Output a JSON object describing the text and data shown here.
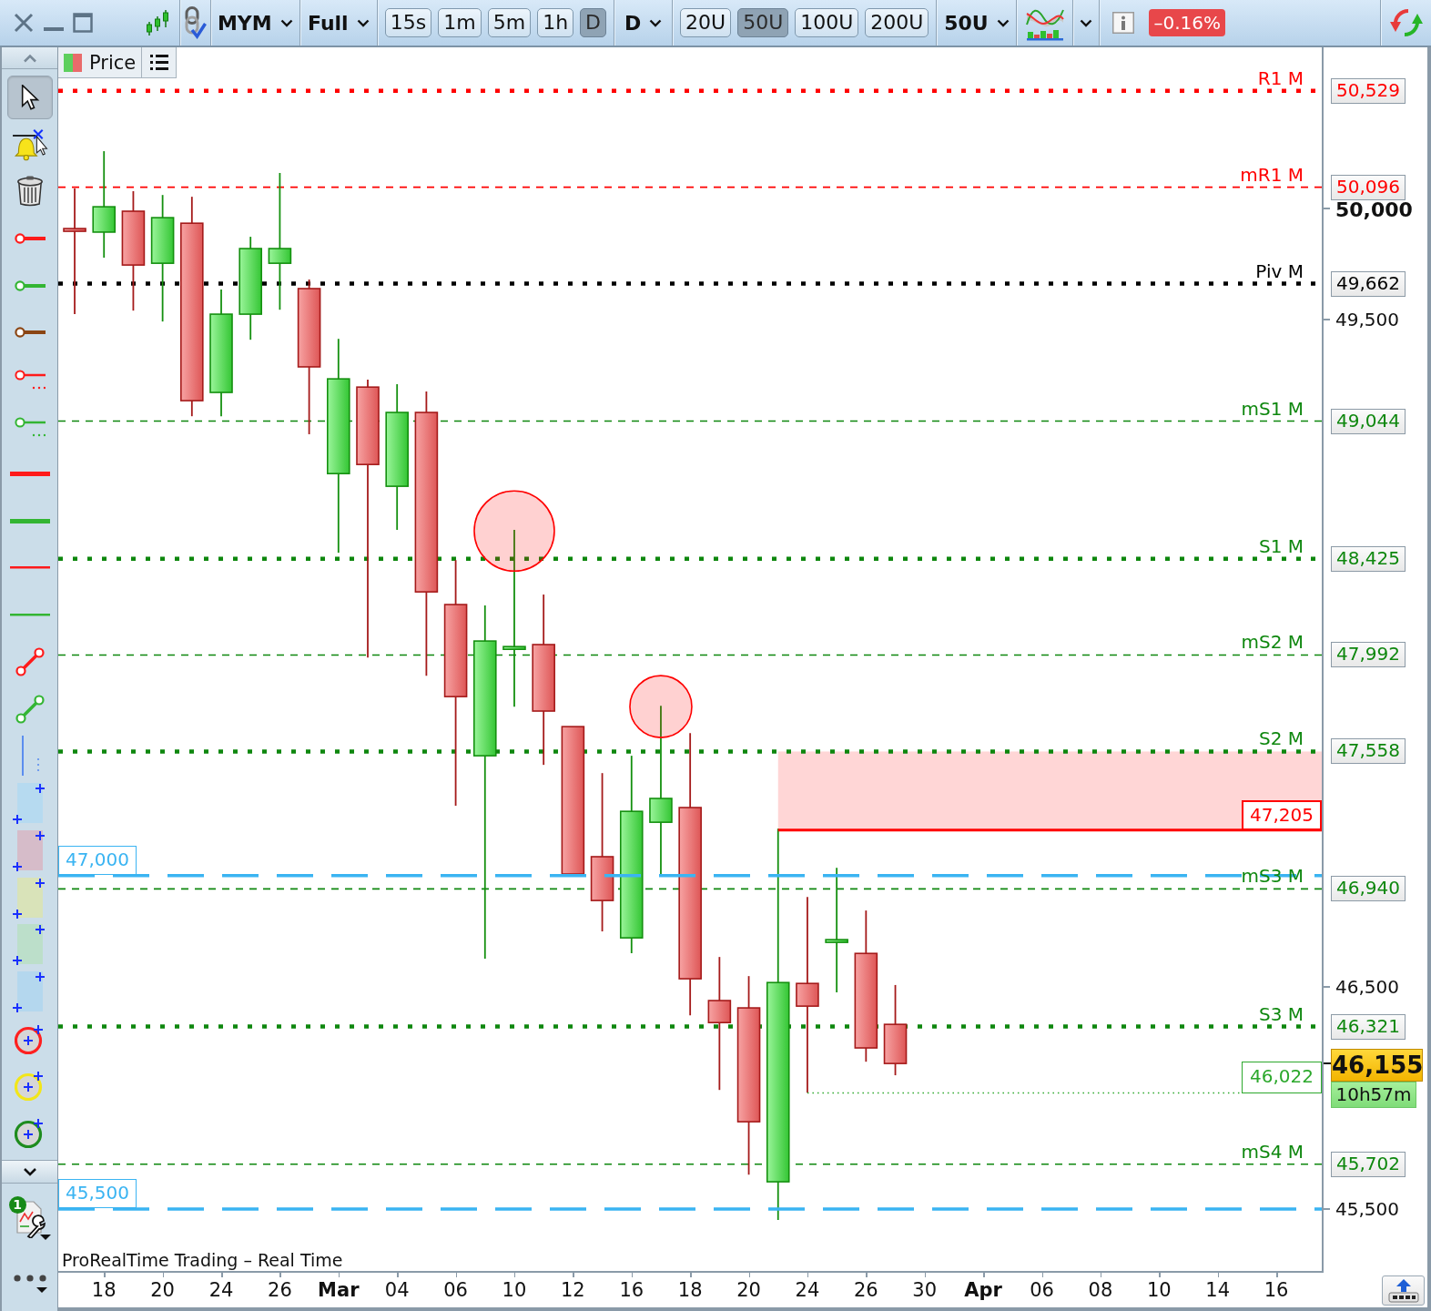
{
  "toolbar": {
    "instrument": "MYM",
    "range": "Full",
    "timeframes": [
      {
        "label": "15s",
        "selected": false
      },
      {
        "label": "1m",
        "selected": false
      },
      {
        "label": "5m",
        "selected": false
      },
      {
        "label": "1h",
        "selected": false
      },
      {
        "label": "D",
        "selected": true
      }
    ],
    "period": "D",
    "units": [
      {
        "label": "20U",
        "selected": false
      },
      {
        "label": "50U",
        "selected": true
      },
      {
        "label": "100U",
        "selected": false
      },
      {
        "label": "200U",
        "selected": false
      }
    ],
    "unit_menu": "50U",
    "change": "–0.16%"
  },
  "left_toolbar": {
    "tools": [
      {
        "kind": "pointer",
        "selected": true
      },
      {
        "kind": "alert",
        "selected": false
      },
      {
        "kind": "trash",
        "selected": false
      },
      {
        "kind": "ray",
        "color": "#ff1a1a",
        "selected": false
      },
      {
        "kind": "ray",
        "color": "#33b533",
        "selected": false
      },
      {
        "kind": "ray",
        "color": "#8b4513",
        "selected": false
      },
      {
        "kind": "ray-dotted",
        "color": "#ff1a1a",
        "selected": false
      },
      {
        "kind": "ray-dotted",
        "color": "#33b533",
        "selected": false
      },
      {
        "kind": "thick-line",
        "color": "#ff1a1a",
        "selected": false
      },
      {
        "kind": "thick-line",
        "color": "#33b533",
        "selected": false
      },
      {
        "kind": "thin-line",
        "color": "#ff1a1a",
        "selected": false
      },
      {
        "kind": "thin-line",
        "color": "#33b533",
        "selected": false
      },
      {
        "kind": "segment",
        "color": "#ff1a1a",
        "selected": false
      },
      {
        "kind": "segment",
        "color": "#33b533",
        "selected": false
      },
      {
        "kind": "vline",
        "color": "#5b8def",
        "selected": false
      },
      {
        "kind": "rect",
        "color": "#b6daf0",
        "selected": false
      },
      {
        "kind": "rect",
        "color": "#d6bcc9",
        "selected": false
      },
      {
        "kind": "rect",
        "color": "#d9e3b9",
        "selected": false
      },
      {
        "kind": "rect",
        "color": "#bcdfca",
        "selected": false
      },
      {
        "kind": "rect",
        "color": "#b4d7ee",
        "selected": false
      },
      {
        "kind": "circle",
        "color": "#ff2020",
        "selected": false
      },
      {
        "kind": "circle",
        "color": "#f2e61a",
        "selected": false
      },
      {
        "kind": "circle",
        "color": "#1e8c1e",
        "selected": false
      }
    ],
    "settings_badge": "1"
  },
  "chart": {
    "legend": "Price",
    "line_tags": [
      {
        "kind": "pivot",
        "text": "50,529"
      },
      {
        "kind": "mid",
        "text": "50,096"
      },
      {
        "kind": "pivot",
        "text": "49,662"
      },
      {
        "kind": "mid",
        "text": "49,044"
      },
      {
        "kind": "pivot",
        "text": "48,425"
      },
      {
        "kind": "mid",
        "text": "47,992"
      },
      {
        "kind": "pivot",
        "text": "47,558"
      },
      {
        "kind": "mid",
        "text": "46,940"
      },
      {
        "kind": "pivot",
        "text": "46,321"
      },
      {
        "kind": "mid",
        "text": "45,702"
      },
      {
        "kind": "guide",
        "text": "47,000"
      },
      {
        "kind": "guide",
        "text": "45,500"
      },
      {
        "kind": "zone",
        "text": "47,205"
      },
      {
        "kind": "target",
        "text": "46,022"
      }
    ],
    "last": {
      "price": "46,155",
      "countdown": "10h57m"
    },
    "footer": "ProRealTime Trading – Real Time",
    "chart_data": {
      "type": "candlestick",
      "categories": [
        null,
        "18",
        null,
        "20",
        null,
        "24",
        null,
        "26",
        null,
        "Mar",
        null,
        "04",
        null,
        "06",
        null,
        "10",
        null,
        "12",
        null,
        "16",
        null,
        "18",
        null,
        "20",
        null,
        "24",
        null,
        "26",
        null,
        "30",
        null,
        "Apr",
        null,
        "06",
        null,
        "08",
        null,
        "10",
        null,
        "14",
        null,
        "16"
      ],
      "ylim": [
        45222,
        50725
      ],
      "yticks": [
        {
          "value": 45500,
          "label": "45,500"
        },
        {
          "value": 46500,
          "label": "46,500"
        },
        {
          "value": 49500,
          "label": "49,500"
        },
        {
          "value": 50000,
          "label": "50,000"
        }
      ],
      "ref_lines": [
        {
          "axis": "y",
          "value": 50529,
          "label": "R1 M",
          "color": "#ff0000"
        },
        {
          "axis": "y",
          "value": 50096,
          "label": "mR1 M",
          "color": "#ff0000"
        },
        {
          "axis": "y",
          "value": 49662,
          "label": "Piv M",
          "color": "#000000"
        },
        {
          "axis": "y",
          "value": 49044,
          "label": "mS1 M",
          "color": "#0e870e"
        },
        {
          "axis": "y",
          "value": 48425,
          "label": "S1 M",
          "color": "#0e870e"
        },
        {
          "axis": "y",
          "value": 47992,
          "label": "mS2 M",
          "color": "#0e870e"
        },
        {
          "axis": "y",
          "value": 47558,
          "label": "S2 M",
          "color": "#0e870e"
        },
        {
          "axis": "y",
          "value": 46940,
          "label": "mS3 M",
          "color": "#0e870e"
        },
        {
          "axis": "y",
          "value": 46321,
          "label": "S3 M",
          "color": "#0e870e"
        },
        {
          "axis": "y",
          "value": 45702,
          "label": "mS4 M",
          "color": "#0e870e"
        },
        {
          "axis": "y",
          "value": 47000,
          "color": "#3ab4f2"
        },
        {
          "axis": "y",
          "value": 45500,
          "color": "#3ab4f2"
        },
        {
          "axis": "y",
          "value": 47205,
          "color": "#ff0000"
        },
        {
          "axis": "y",
          "value": 46022,
          "color": "#2ca82c"
        }
      ],
      "bands": [
        {
          "axis": "y",
          "from": 47205,
          "to": 47558
        }
      ]
    }
  }
}
